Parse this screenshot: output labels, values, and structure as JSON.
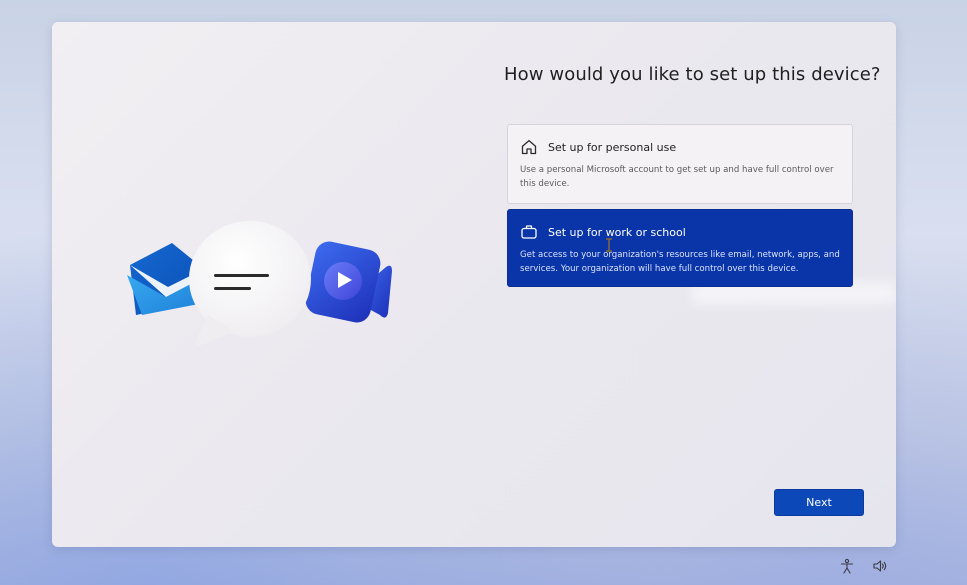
{
  "setup": {
    "title": "How would you like to set up this device?",
    "options": [
      {
        "id": "personal",
        "icon": "home-icon",
        "title": "Set up for personal use",
        "description": "Use a personal Microsoft account to get set up and have full control over this device.",
        "selected": false
      },
      {
        "id": "work",
        "icon": "briefcase-icon",
        "title": "Set up for work or school",
        "description": "Get access to your organization's resources like email, network, apps, and services. Your organization will have full control over this device.",
        "selected": true
      }
    ],
    "next_label": "Next"
  },
  "illustration": {
    "icons": [
      "mail-icon",
      "chat-bubble-icon",
      "video-camera-icon"
    ]
  },
  "tray": {
    "icons": [
      "accessibility-icon",
      "volume-icon"
    ]
  },
  "colors": {
    "accent": "#0a35a8",
    "next_button": "#0d48b9",
    "card_border": "#d6d4da"
  }
}
